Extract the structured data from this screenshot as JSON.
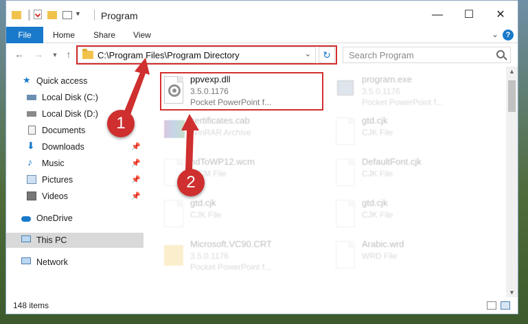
{
  "window": {
    "title": "Program",
    "minimize_glyph": "—",
    "maximize_glyph": "☐",
    "close_glyph": "✕"
  },
  "ribbon": {
    "file": "File",
    "tabs": [
      "Home",
      "Share",
      "View"
    ],
    "help": "?"
  },
  "address": {
    "path": "C:\\Program Files\\Program Directory"
  },
  "search": {
    "placeholder": "Search Program"
  },
  "sidebar": {
    "items": [
      {
        "label": "Quick access",
        "icon": "star-icon",
        "pinned": false
      },
      {
        "label": "Local Disk (C:)",
        "icon": "drive-icon",
        "pinned": false
      },
      {
        "label": "Local Disk (D:)",
        "icon": "drive-icon",
        "pinned": false
      },
      {
        "label": "Documents",
        "icon": "documents-icon",
        "pinned": false
      },
      {
        "label": "Downloads",
        "icon": "download-icon",
        "pinned": true
      },
      {
        "label": "Music",
        "icon": "music-icon",
        "pinned": true
      },
      {
        "label": "Pictures",
        "icon": "pictures-icon",
        "pinned": true
      },
      {
        "label": "Videos",
        "icon": "videos-icon",
        "pinned": true
      },
      {
        "label": "OneDrive",
        "icon": "cloud-icon",
        "pinned": false
      },
      {
        "label": "This PC",
        "icon": "computer-icon",
        "pinned": false,
        "selected": true
      },
      {
        "label": "Network",
        "icon": "network-icon",
        "pinned": false
      }
    ]
  },
  "files": [
    {
      "name": "ppvexp.dll",
      "line2": "3.5.0.1176",
      "line3": "Pocket PowerPoint f...",
      "highlighted": true
    },
    {
      "name": "program.exe",
      "line2": "3.5.0.1176",
      "line3": "Pocket PowerPoint f..."
    },
    {
      "name": "certificates.cab",
      "line2": "WinRAR Archive",
      "line3": ""
    },
    {
      "name": "gtd.cjk",
      "line2": "CJK File",
      "line3": ""
    },
    {
      "name": "ndToWP12.wcm",
      "line2": "WCM File",
      "line3": ""
    },
    {
      "name": "DefaultFont.cjk",
      "line2": "CJK File",
      "line3": ""
    },
    {
      "name": "gtd.cjk",
      "line2": "CJK File",
      "line3": ""
    },
    {
      "name": "gtd.cjk",
      "line2": "CJK File",
      "line3": ""
    },
    {
      "name": "Microsoft.VC90.CRT",
      "line2": "3.5.0.1176",
      "line3": "Pocket PowerPoint f..."
    },
    {
      "name": "Arabic.wrd",
      "line2": "WRD File",
      "line3": ""
    }
  ],
  "status": {
    "count": "148 items"
  },
  "callouts": [
    "1",
    "2"
  ],
  "colors": {
    "accent": "#1979ca",
    "highlight_red": "#d52d2d",
    "callout_red": "#cf2f2f"
  }
}
